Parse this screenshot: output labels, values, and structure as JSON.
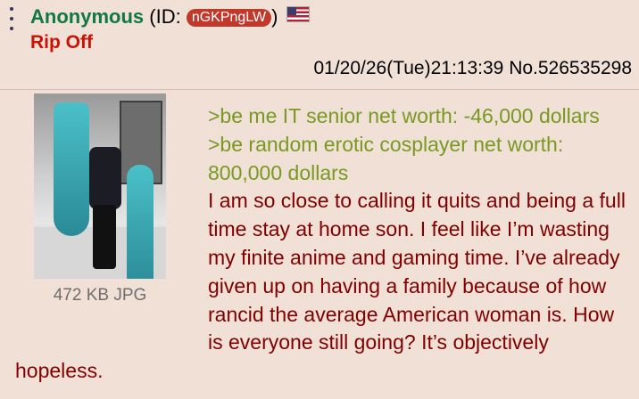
{
  "post": {
    "name": "Anonymous",
    "id_prefix": "(ID: ",
    "id_value": "nGKPngLW",
    "id_suffix": ")",
    "country_flag_icon": "us-flag-icon",
    "subject": "Rip Off",
    "datetime": "01/20/26(Tue)21:13:39",
    "post_number": "No.526535298",
    "file_info": "472 KB JPG",
    "greentext": [
      ">be me IT senior net worth: -46,000 dollars",
      ">be random erotic cosplayer net worth: 800,000 dollars"
    ],
    "body": "I am so close to calling it quits and being a full time stay at home son. I feel like I’m wasting my finite anime and gaming time. I’ve already given up on having a family because of how rancid the average American woman is. How is everyone still going? It’s objectively hopeless."
  },
  "colors": {
    "background": "#f0e0d6",
    "name": "#117743",
    "subject": "#cc1105",
    "greentext": "#789922",
    "body_text": "#800000",
    "id_pill": "#c0392b"
  },
  "icons": {
    "menu": "vertical-dots-menu-icon",
    "flag": "us-flag-icon"
  }
}
